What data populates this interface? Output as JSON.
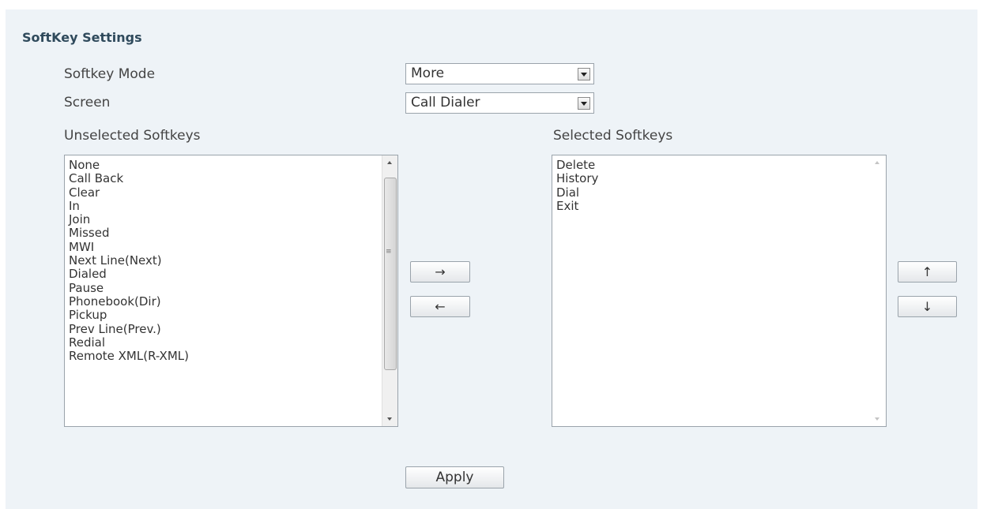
{
  "section": {
    "title": "SoftKey Settings"
  },
  "softkey_mode": {
    "label": "Softkey Mode",
    "value": "More"
  },
  "screen": {
    "label": "Screen",
    "value": "Call Dialer"
  },
  "unselected": {
    "label": "Unselected Softkeys",
    "items": [
      "None",
      "Call Back",
      "Clear",
      "In",
      "Join",
      "Missed",
      "MWI",
      "Next Line(Next)",
      "Dialed",
      "Pause",
      "Phonebook(Dir)",
      "Pickup",
      "Prev Line(Prev.)",
      "Redial",
      "Remote XML(R-XML)"
    ]
  },
  "selected": {
    "label": "Selected Softkeys",
    "items": [
      "Delete",
      "History",
      "Dial",
      "Exit"
    ]
  },
  "buttons": {
    "move_right": "→",
    "move_left": "←",
    "move_up": "↑",
    "move_down": "↓",
    "apply": "Apply"
  },
  "icons": {
    "dropdown": "chevron-down-icon",
    "scroll_up": "scroll-up-icon",
    "scroll_down": "scroll-down-icon"
  }
}
